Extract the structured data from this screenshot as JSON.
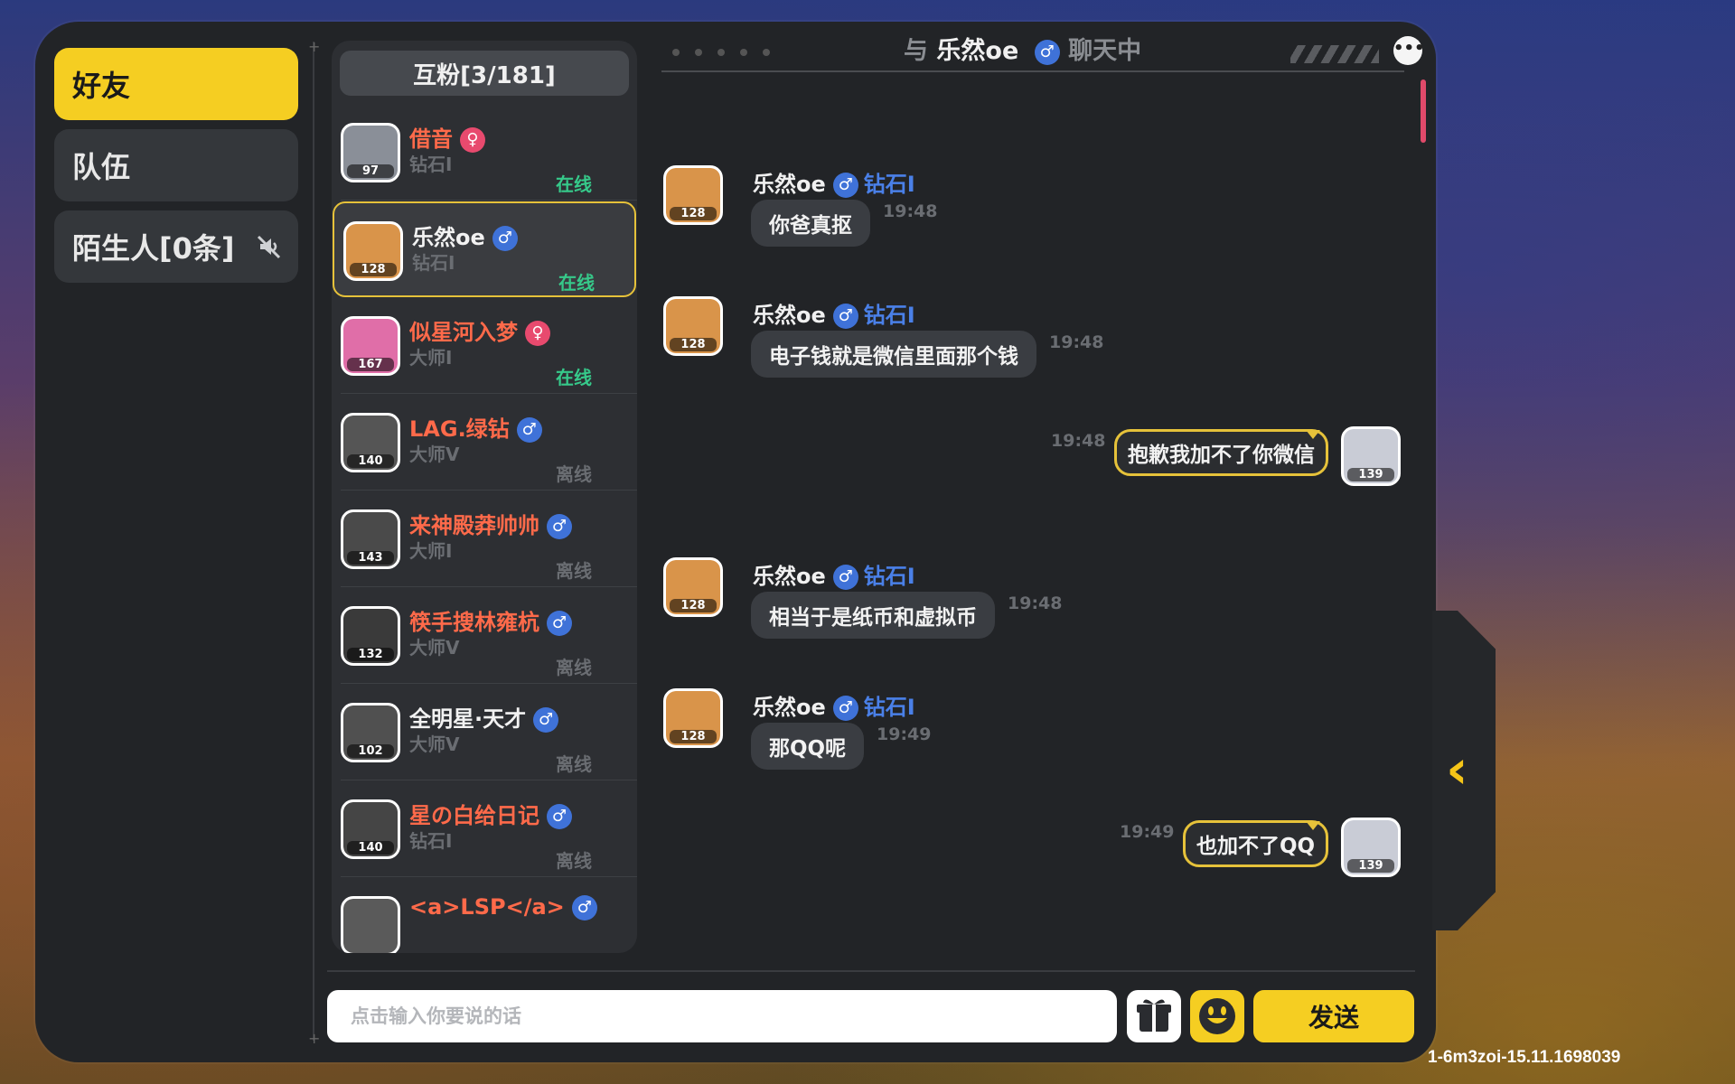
{
  "nav": {
    "friends_label": "好友",
    "team_label": "队伍",
    "strangers_label": "陌生人[0条]"
  },
  "friend_list": {
    "header": "互粉[3/181]",
    "items": [
      {
        "name": "借音",
        "gender": "female",
        "level": "97",
        "rank": "钻石I",
        "status": "在线",
        "online": true,
        "name_color": "#ff6a4a"
      },
      {
        "name": "乐然oe",
        "gender": "male",
        "level": "128",
        "rank": "钻石I",
        "status": "在线",
        "online": true,
        "name_color": "#f2f2f2",
        "selected": true
      },
      {
        "name": "似星河入梦",
        "gender": "female",
        "level": "167",
        "rank": "大师I",
        "status": "在线",
        "online": true,
        "name_color": "#ff6a4a"
      },
      {
        "name": "LAG.绿钻",
        "gender": "male",
        "level": "140",
        "rank": "大师V",
        "status": "离线",
        "online": false,
        "name_color": "#ff6a4a"
      },
      {
        "name": "来神殿莽帅帅",
        "gender": "male",
        "level": "143",
        "rank": "大师I",
        "status": "离线",
        "online": false,
        "name_color": "#ff6a4a"
      },
      {
        "name": "筷手搜林雍杭",
        "gender": "male",
        "level": "132",
        "rank": "大师V",
        "status": "离线",
        "online": false,
        "name_color": "#ff6a4a"
      },
      {
        "name": "全明星·天才",
        "gender": "male",
        "level": "102",
        "rank": "大师V",
        "status": "离线",
        "online": false,
        "name_color": "#f2f2f2"
      },
      {
        "name": "星の白给日记",
        "gender": "male",
        "level": "140",
        "rank": "钻石I",
        "status": "离线",
        "online": false,
        "name_color": "#ff6a4a"
      },
      {
        "name": "<a>LSP</a>",
        "gender": "male",
        "level": "",
        "rank": "",
        "status": "",
        "online": false,
        "name_color": "#ff6a4a"
      }
    ]
  },
  "chat": {
    "title_prefix": "与",
    "title_name": "乐然oe",
    "title_suffix": "聊天中",
    "gender_symbol": "♂",
    "female_symbol": "♀",
    "messages": [
      {
        "from": "other",
        "name": "乐然oe",
        "rank": "钻石I",
        "level": "128",
        "text": "你爸真抠",
        "time": "19:48"
      },
      {
        "from": "other",
        "name": "乐然oe",
        "rank": "钻石I",
        "level": "128",
        "text": "电子钱就是微信里面那个钱",
        "time": "19:48"
      },
      {
        "from": "me",
        "level": "139",
        "text": "抱歉我加不了你微信",
        "time": "19:48"
      },
      {
        "from": "other",
        "name": "乐然oe",
        "rank": "钻石I",
        "level": "128",
        "text": "相当于是纸币和虚拟币",
        "time": "19:48"
      },
      {
        "from": "other",
        "name": "乐然oe",
        "rank": "钻石I",
        "level": "128",
        "text": "那QQ呢",
        "time": "19:49"
      },
      {
        "from": "me",
        "level": "139",
        "text": "也加不了QQ",
        "time": "19:49"
      }
    ]
  },
  "input": {
    "placeholder": "点击输入你要说的话",
    "value": "",
    "send_label": "发送"
  },
  "icons": {
    "more": "more-icon",
    "gift": "gift-icon",
    "emoji": "emoji-icon",
    "mute": "mute-icon",
    "collapse": "chevron-left-icon"
  },
  "colors": {
    "accent": "#f5ce22",
    "online": "#36c98a",
    "male": "#3f72d8",
    "female": "#e84a6e",
    "rank_blue": "#4a80e8"
  },
  "version": "1-6m3zoi-15.11.1698039"
}
